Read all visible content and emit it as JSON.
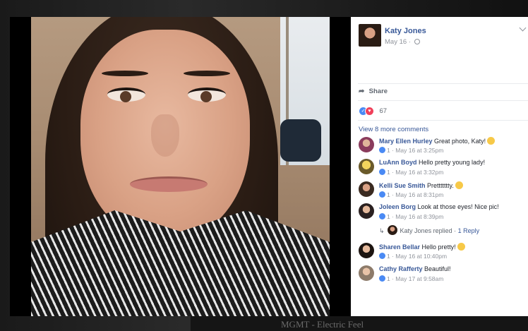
{
  "background_caption": "MGMT - Electric Feel",
  "post": {
    "author": "Katy Jones",
    "date": "May 16",
    "privacy_icon": "globe-icon"
  },
  "actions": {
    "share_label": "Share",
    "share_icon": "share-arrow-icon"
  },
  "reactions": {
    "types": [
      "like",
      "love"
    ],
    "count": "67"
  },
  "comments_link": "View 8 more comments",
  "comments": [
    {
      "name": "Mary Ellen Hurley",
      "text": "Great photo, Katy!",
      "likes": "1",
      "time": "May 16 at 3:25pm",
      "emoji": true
    },
    {
      "name": "LuAnn Boyd",
      "text": "Hello pretty young lady!",
      "likes": "1",
      "time": "May 16 at 3:32pm",
      "emoji": false
    },
    {
      "name": "Kelli Sue Smith",
      "text": "Prettttttty.",
      "likes": "1",
      "time": "May 16 at 8:31pm",
      "emoji": true
    },
    {
      "name": "Joleen Borg",
      "text": "Look at those eyes! Nice pic!",
      "likes": "1",
      "time": "May 16 at 8:39pm",
      "emoji": false
    },
    {
      "name": "Sharen Bellar",
      "text": "Hello pretty!",
      "likes": "1",
      "time": "May 16 at 10:40pm",
      "emoji": true
    },
    {
      "name": "Cathy Rafferty",
      "text": "Beautiful!",
      "likes": "1",
      "time": "May 17 at 9:58am",
      "emoji": false
    }
  ],
  "reply": {
    "author": "Katy Jones",
    "text": "replied",
    "count_label": "1 Reply"
  },
  "colors": {
    "link_blue": "#385898",
    "like_blue": "#4a8af4",
    "love_red": "#f0405a",
    "muted_gray": "#90949c"
  }
}
